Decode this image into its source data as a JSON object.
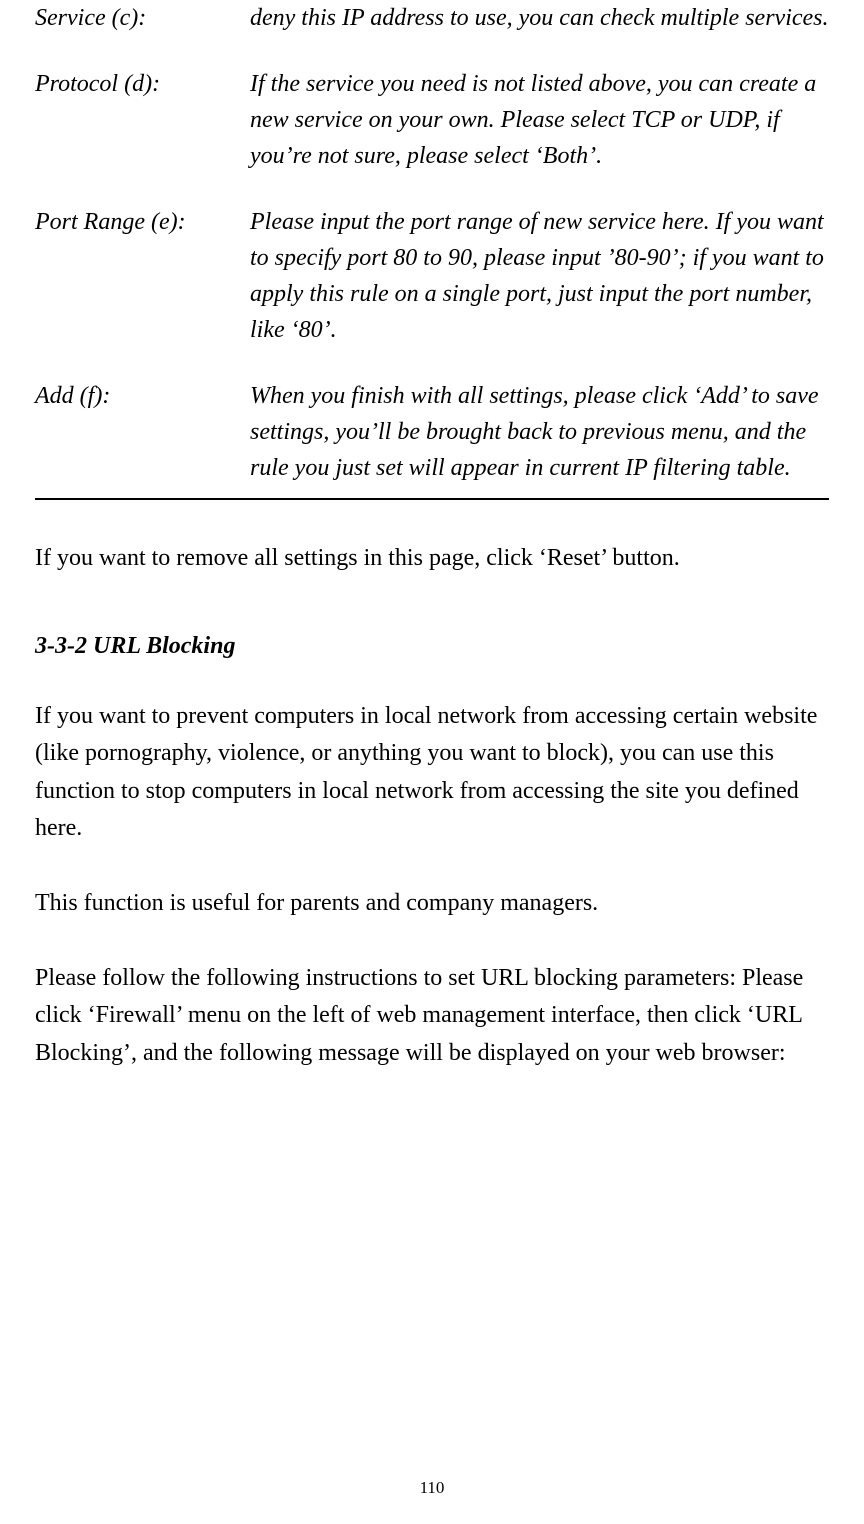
{
  "definitions": [
    {
      "term": "Service (c):",
      "desc": "deny this IP address to use, you can check multiple services."
    },
    {
      "term": "Protocol (d):",
      "desc": "If the service you need is not listed above, you can create a new service on your own. Please select TCP or UDP, if you’re not sure, please select ‘Both’."
    },
    {
      "term": "Port Range (e):",
      "desc": "Please input the port range of new service here. If you want to specify port 80 to 90, please input ’80-90’; if you want to apply this rule on a single port, just input the port number, like ‘80’."
    },
    {
      "term": "Add (f):",
      "desc": "When you finish with all settings, please click ‘Add’ to save settings, you’ll be brought back to previous menu, and the rule you just set will appear in current IP filtering table."
    }
  ],
  "reset_note": "If you want to remove all settings in this page, click ‘Reset’ button.",
  "section_title": "3-3-2 URL Blocking",
  "para1": "If you want to prevent computers in local network from accessing certain website (like pornography, violence, or anything you want to block), you can use this function to stop computers in local network from accessing the site you defined here.",
  "para2": "This function is useful for parents and company managers.",
  "para3": "Please follow the following instructions to set URL blocking parameters: Please click ‘Firewall’ menu on the left of web management interface, then click ‘URL Blocking’, and the following message will be displayed on your web browser:",
  "page_number": "110"
}
